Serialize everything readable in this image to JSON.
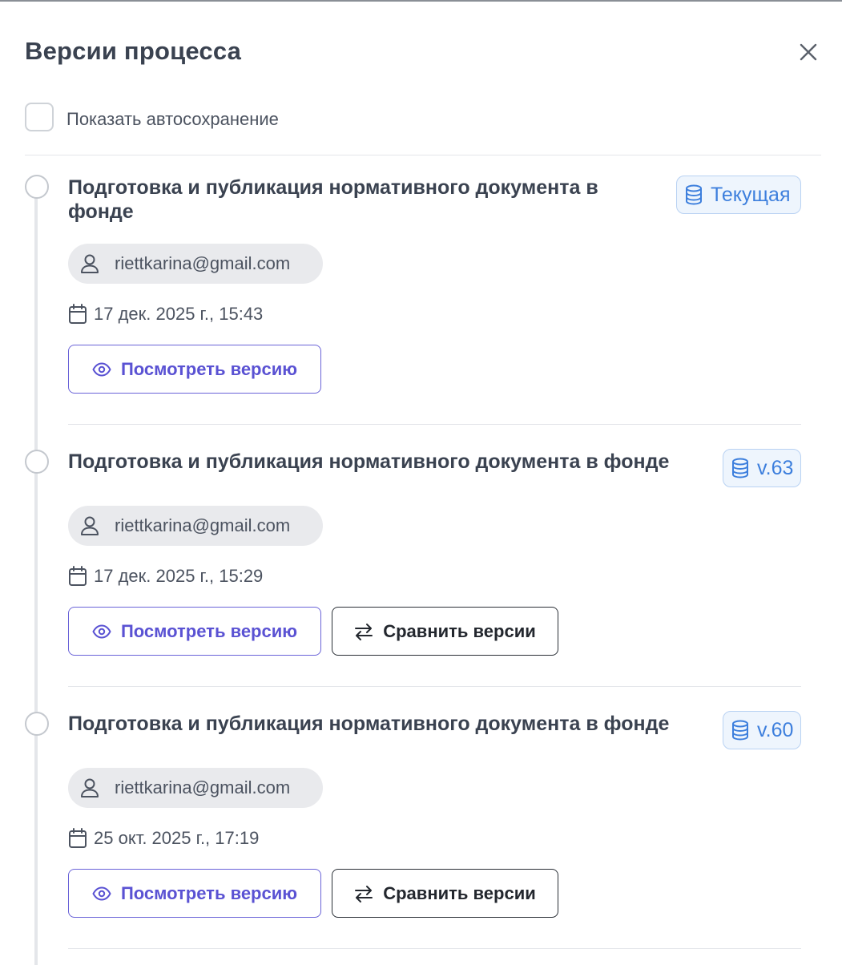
{
  "panel": {
    "title": "Версии процесса",
    "close_icon": "close-icon",
    "autosave_checkbox": {
      "label": "Показать автосохранение",
      "checked": false
    }
  },
  "versions": [
    {
      "title": "Подготовка и публикация нормативного документа в фонде",
      "badge": "Текущая",
      "user": "riettkarina@gmail.com",
      "date": "17 дек. 2025 г., 15:43",
      "view_label": "Посмотреть версию",
      "compare_label": null
    },
    {
      "title": "Подготовка и публикация нормативного документа в фонде",
      "badge": "v.63",
      "user": "riettkarina@gmail.com",
      "date": "17 дек. 2025 г., 15:29",
      "view_label": "Посмотреть версию",
      "compare_label": "Сравнить версии"
    },
    {
      "title": "Подготовка и публикация нормативного документа в фонде",
      "badge": "v.60",
      "user": "riettkarina@gmail.com",
      "date": "25 окт. 2025 г., 17:19",
      "view_label": "Посмотреть версию",
      "compare_label": "Сравнить версии"
    }
  ],
  "icons": {
    "badge": "database-icon",
    "user": "user-icon",
    "date": "calendar-icon",
    "view": "eye-icon",
    "compare": "swap-arrows-icon"
  },
  "colors": {
    "accent": "#5a52d3",
    "badge_text": "#3d7fdd",
    "badge_bg": "#eef5fd",
    "text": "#3a4250"
  }
}
